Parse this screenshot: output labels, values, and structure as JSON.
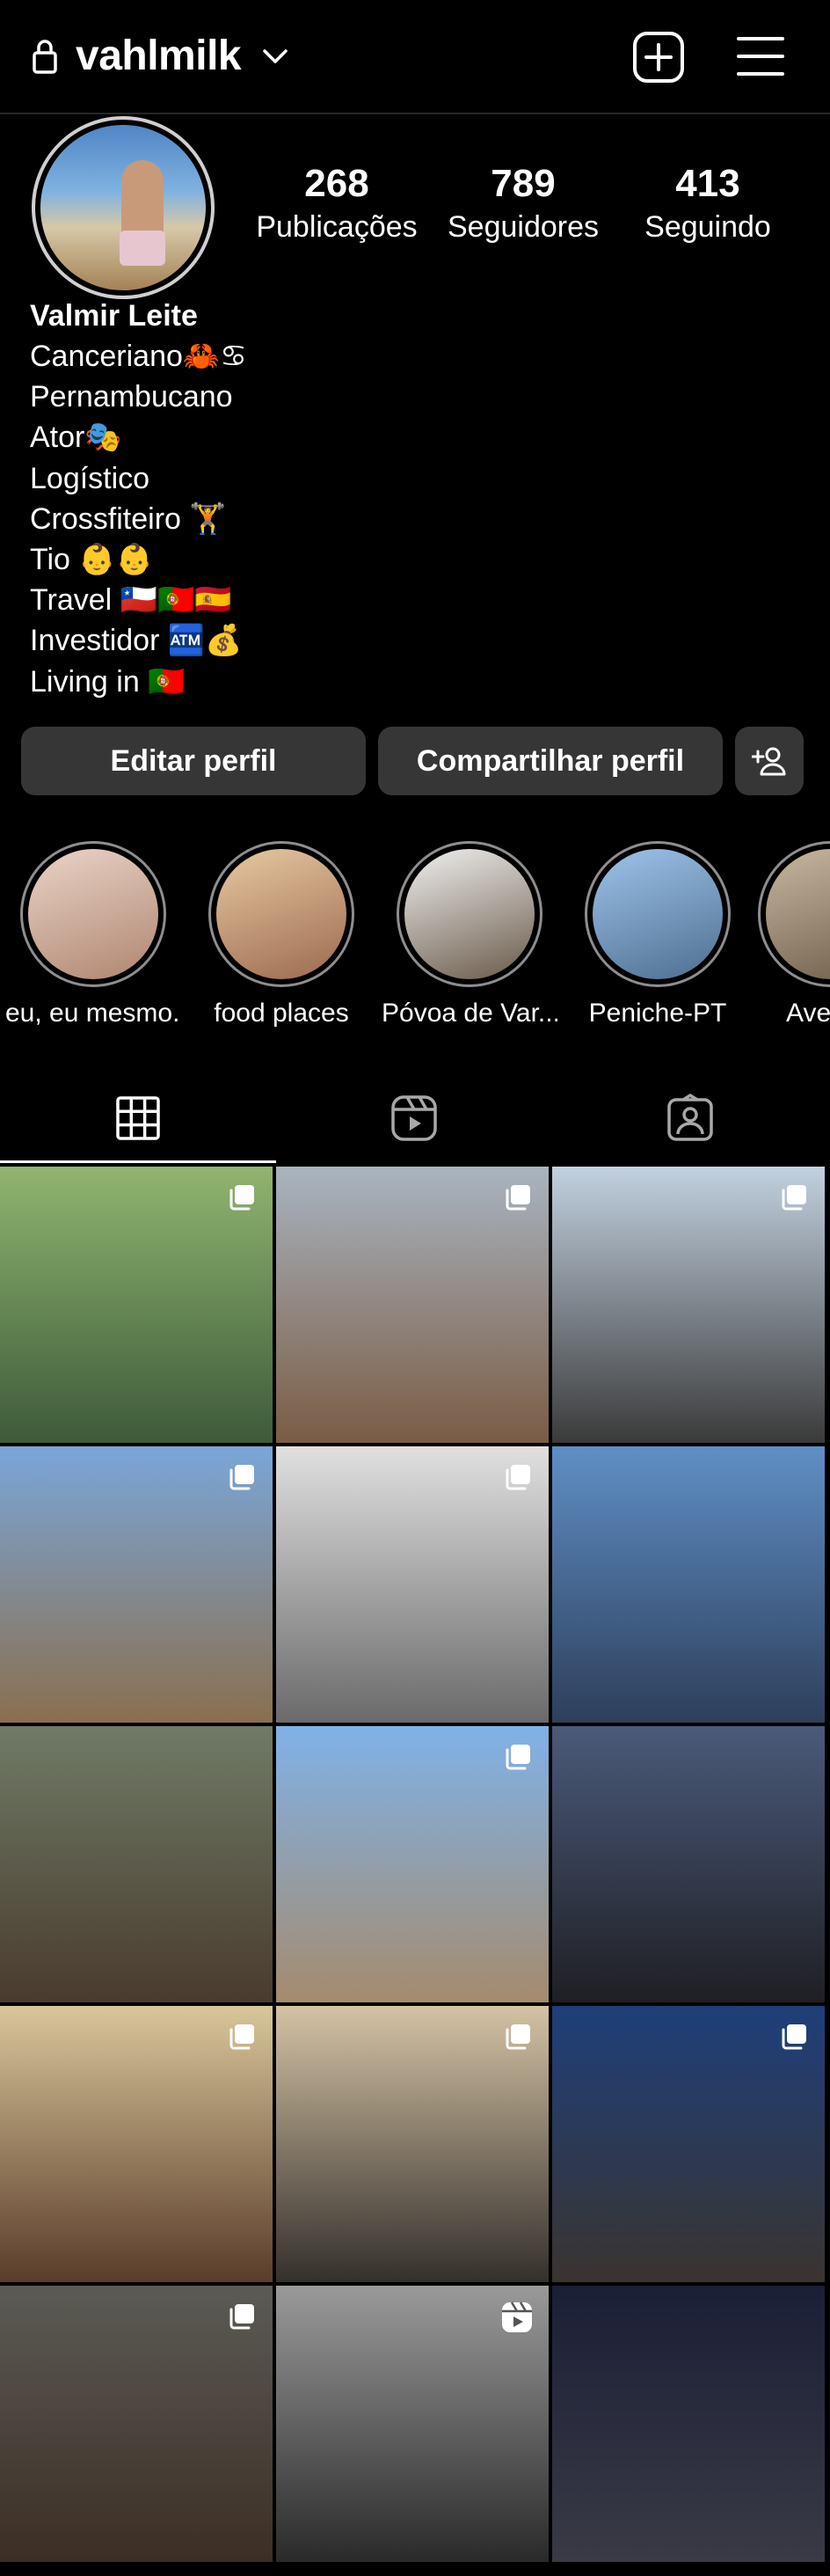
{
  "header": {
    "username": "vahlmilk"
  },
  "profile": {
    "stats": [
      {
        "value": "268",
        "label": "Publicações"
      },
      {
        "value": "789",
        "label": "Seguidores"
      },
      {
        "value": "413",
        "label": "Seguindo"
      }
    ],
    "name": "Valmir Leite",
    "bio": [
      "Canceriano🦀♋",
      "Pernambucano",
      "Ator🎭",
      "Logístico",
      "Crossfiteiro 🏋",
      "Tio 👶👶",
      "Travel 🇨🇱🇵🇹🇪🇸",
      "Investidor 🏧💰",
      "Living in 🇵🇹"
    ]
  },
  "actions": {
    "edit_label": "Editar perfil",
    "share_label": "Compartilhar perfil"
  },
  "highlights": [
    {
      "label": "eu, eu mesmo..",
      "colors": [
        "#e9d4c8",
        "#b08670"
      ]
    },
    {
      "label": "food places",
      "colors": [
        "#e7c9a2",
        "#9c6a4e"
      ]
    },
    {
      "label": "Póvoa de Var...",
      "colors": [
        "#f0f0f0",
        "#6a5a49"
      ]
    },
    {
      "label": "Peniche-PT",
      "colors": [
        "#9fc3ea",
        "#4d6f90"
      ]
    },
    {
      "label": "Ave",
      "colors": [
        "#c9b8a0",
        "#6d5d49"
      ]
    }
  ],
  "grid": {
    "rows": [
      [
        {
          "top": "#8fb570",
          "bottom": "#3e5a3a",
          "badge": "multi"
        },
        {
          "top": "#a9b4c0",
          "bottom": "#7a5c44",
          "badge": "multi"
        },
        {
          "top": "#c2d1e0",
          "bottom": "#3a3a3a",
          "badge": "multi"
        }
      ],
      [
        {
          "top": "#7aa6d9",
          "bottom": "#8a6f4e",
          "badge": "multi"
        },
        {
          "top": "#e0e0e0",
          "bottom": "#6a6a6a",
          "badge": "multi"
        },
        {
          "top": "#5f8fc6",
          "bottom": "#2d3f5a",
          "badge": "none"
        }
      ],
      [
        {
          "top": "#6f7b66",
          "bottom": "#4a3b2f",
          "badge": "none"
        },
        {
          "top": "#7fb2e8",
          "bottom": "#a58b6e",
          "badge": "multi"
        },
        {
          "top": "#4a5a7a",
          "bottom": "#1f1f24",
          "badge": "none"
        }
      ],
      [
        {
          "top": "#d9c69a",
          "bottom": "#5a3c2a",
          "badge": "multi"
        },
        {
          "top": "#d4c2a4",
          "bottom": "#34302c",
          "badge": "multi"
        },
        {
          "top": "#1e3f7a",
          "bottom": "#3a3430",
          "badge": "multi"
        }
      ],
      [
        {
          "top": "#5b5b55",
          "bottom": "#3c2e24",
          "badge": "multi"
        },
        {
          "top": "#9a9a9a",
          "bottom": "#2a2a2a",
          "badge": "reel"
        },
        {
          "top": "#1b1f36",
          "bottom": "#3a3a46",
          "badge": "none"
        }
      ]
    ]
  }
}
